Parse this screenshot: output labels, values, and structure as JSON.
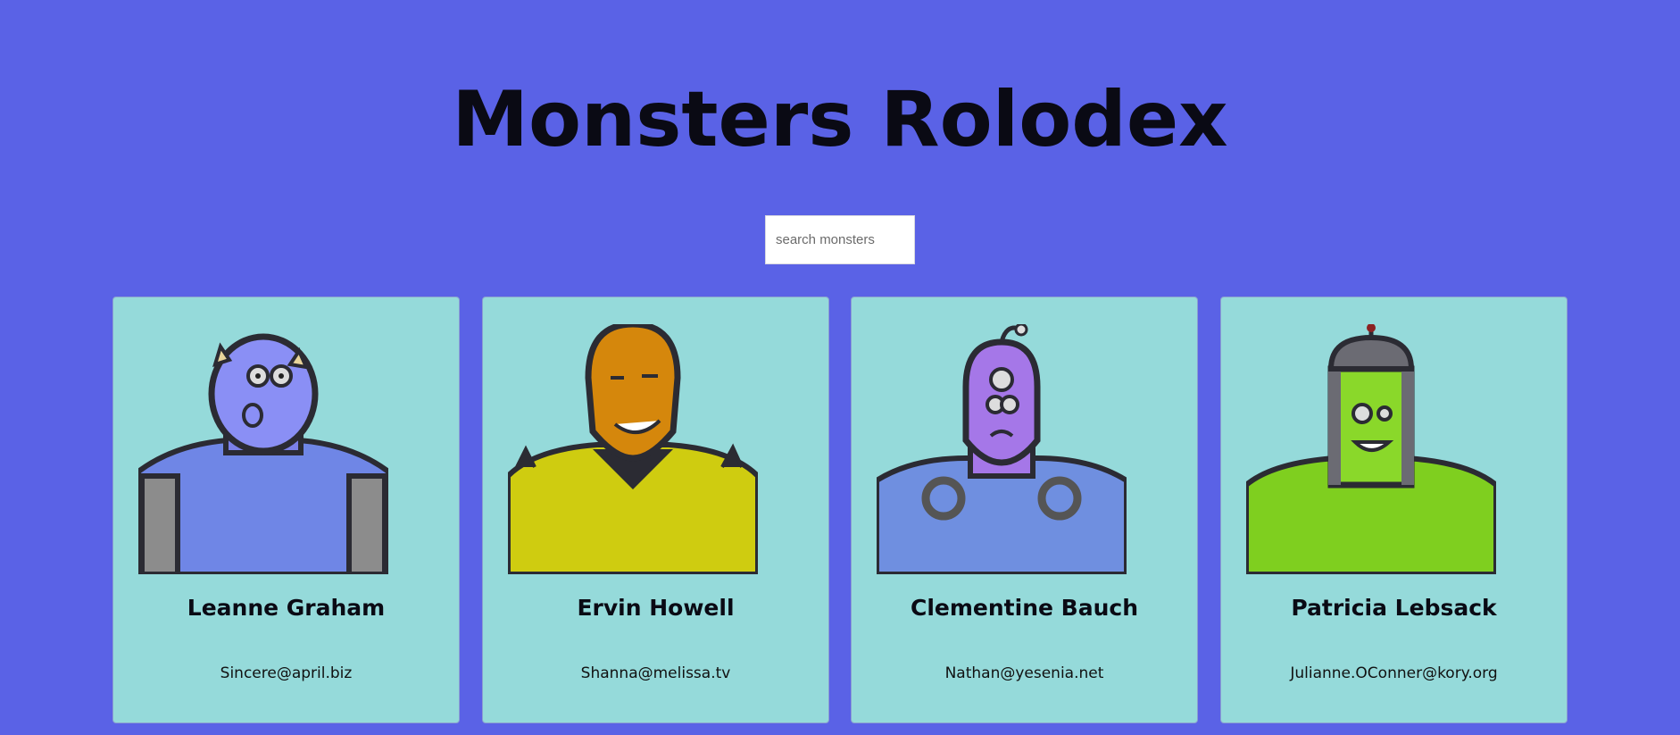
{
  "header": {
    "title": "Monsters Rolodex"
  },
  "search": {
    "placeholder": "search monsters"
  },
  "monsters": [
    {
      "name": "Leanne Graham",
      "email": "Sincere@april.biz",
      "body_color": "#6f86e6",
      "skin_color": "#8a8ff5",
      "icon": "blue-horned-monster-icon"
    },
    {
      "name": "Ervin Howell",
      "email": "Shanna@melissa.tv",
      "body_color": "#cfcc10",
      "skin_color": "#d5870c",
      "icon": "orange-spiky-monster-icon"
    },
    {
      "name": "Clementine Bauch",
      "email": "Nathan@yesenia.net",
      "body_color": "#6f8fe0",
      "skin_color": "#a577e8",
      "icon": "purple-cyclops-monster-icon"
    },
    {
      "name": "Patricia Lebsack",
      "email": "Julianne.OConner@kory.org",
      "body_color": "#7fcf1f",
      "skin_color": "#8ad82a",
      "icon": "green-helmet-monster-icon"
    }
  ]
}
